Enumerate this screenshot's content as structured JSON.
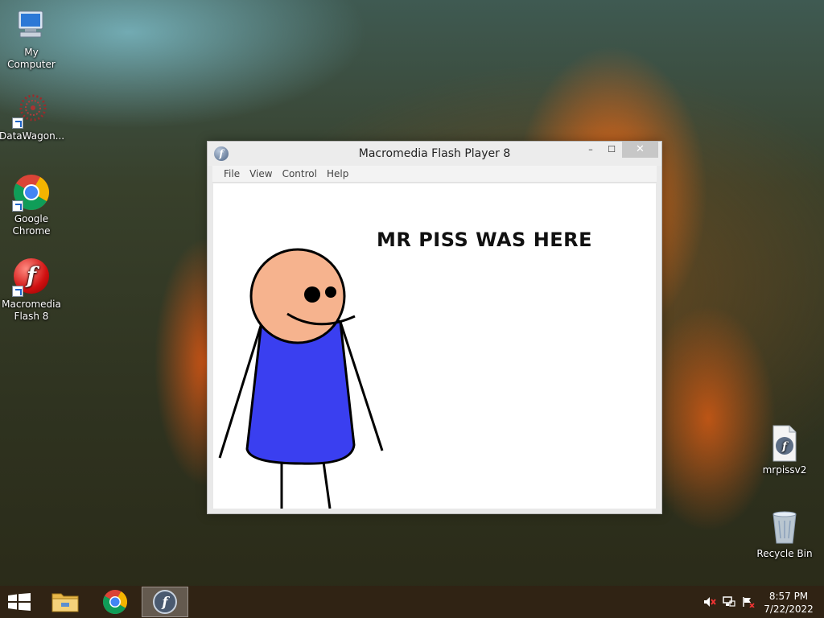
{
  "desktop": {
    "icons_left": [
      {
        "label": "My Computer",
        "icon": "computer-icon"
      },
      {
        "label": "DataWagon...",
        "icon": "datawagon-icon"
      },
      {
        "label": "Google Chrome",
        "icon": "chrome-icon"
      },
      {
        "label": "Macromedia Flash 8",
        "icon": "flash-icon"
      }
    ],
    "icons_right": [
      {
        "label": "mrpissv2",
        "icon": "swf-file-icon"
      },
      {
        "label": "Recycle Bin",
        "icon": "recycle-bin-icon"
      }
    ]
  },
  "window": {
    "title": "Macromedia Flash Player 8",
    "minimize_glyph": "–",
    "maximize_glyph": "☐",
    "close_glyph": "✕",
    "menu": [
      "File",
      "View",
      "Control",
      "Help"
    ],
    "stage_text": "MR PISS WAS HERE",
    "stage_colors": {
      "skin": "#f6b38e",
      "shirt": "#3a3ff0"
    }
  },
  "taskbar": {
    "buttons": [
      {
        "name": "file-explorer",
        "icon": "folder-icon",
        "active": false
      },
      {
        "name": "chrome",
        "icon": "chrome-icon",
        "active": false
      },
      {
        "name": "flash-player",
        "icon": "flash-icon",
        "active": true
      }
    ],
    "time": "8:57 PM",
    "date": "7/22/2022"
  }
}
